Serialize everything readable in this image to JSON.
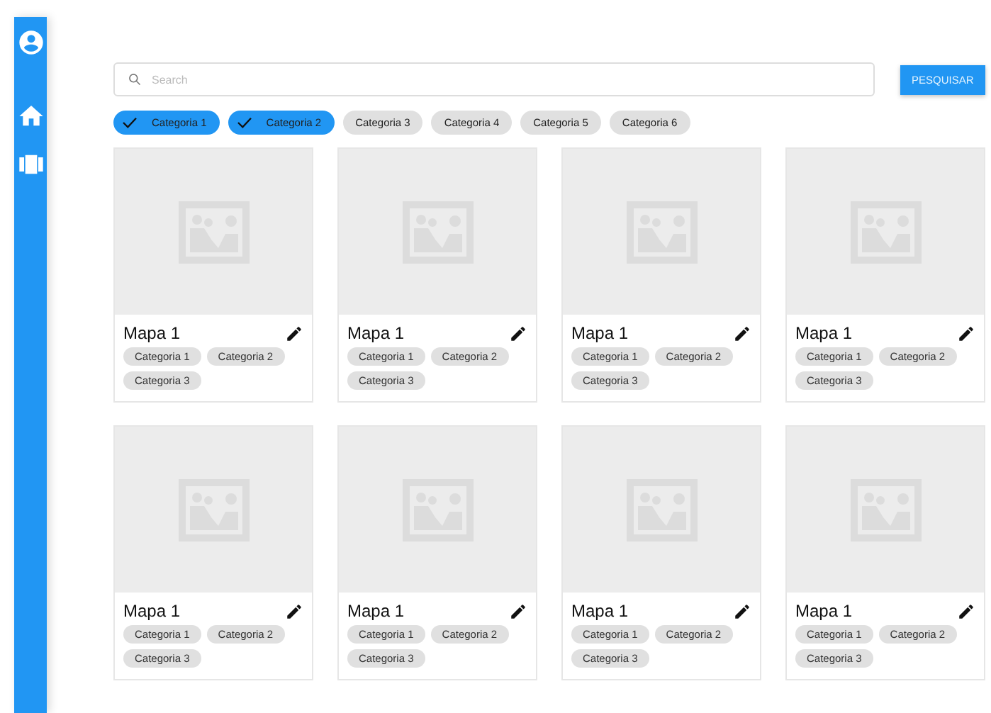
{
  "search": {
    "placeholder": "Search",
    "button": "PESQUISAR"
  },
  "filters": [
    {
      "label": "Categoria 1",
      "selected": true
    },
    {
      "label": "Categoria 2",
      "selected": true
    },
    {
      "label": "Categoria 3",
      "selected": false
    },
    {
      "label": "Categoria 4",
      "selected": false
    },
    {
      "label": "Categoria 5",
      "selected": false
    },
    {
      "label": "Categoria 6",
      "selected": false
    }
  ],
  "cards": [
    {
      "title": "Mapa 1",
      "tags": [
        "Categoria 1",
        "Categoria 2",
        "Categoria 3"
      ]
    },
    {
      "title": "Mapa 1",
      "tags": [
        "Categoria 1",
        "Categoria 2",
        "Categoria 3"
      ]
    },
    {
      "title": "Mapa 1",
      "tags": [
        "Categoria 1",
        "Categoria 2",
        "Categoria 3"
      ]
    },
    {
      "title": "Mapa 1",
      "tags": [
        "Categoria 1",
        "Categoria 2",
        "Categoria 3"
      ]
    },
    {
      "title": "Mapa 1",
      "tags": [
        "Categoria 1",
        "Categoria 2",
        "Categoria 3"
      ]
    },
    {
      "title": "Mapa 1",
      "tags": [
        "Categoria 1",
        "Categoria 2",
        "Categoria 3"
      ]
    },
    {
      "title": "Mapa 1",
      "tags": [
        "Categoria 1",
        "Categoria 2",
        "Categoria 3"
      ]
    },
    {
      "title": "Mapa 1",
      "tags": [
        "Categoria 1",
        "Categoria 2",
        "Categoria 3"
      ]
    }
  ]
}
